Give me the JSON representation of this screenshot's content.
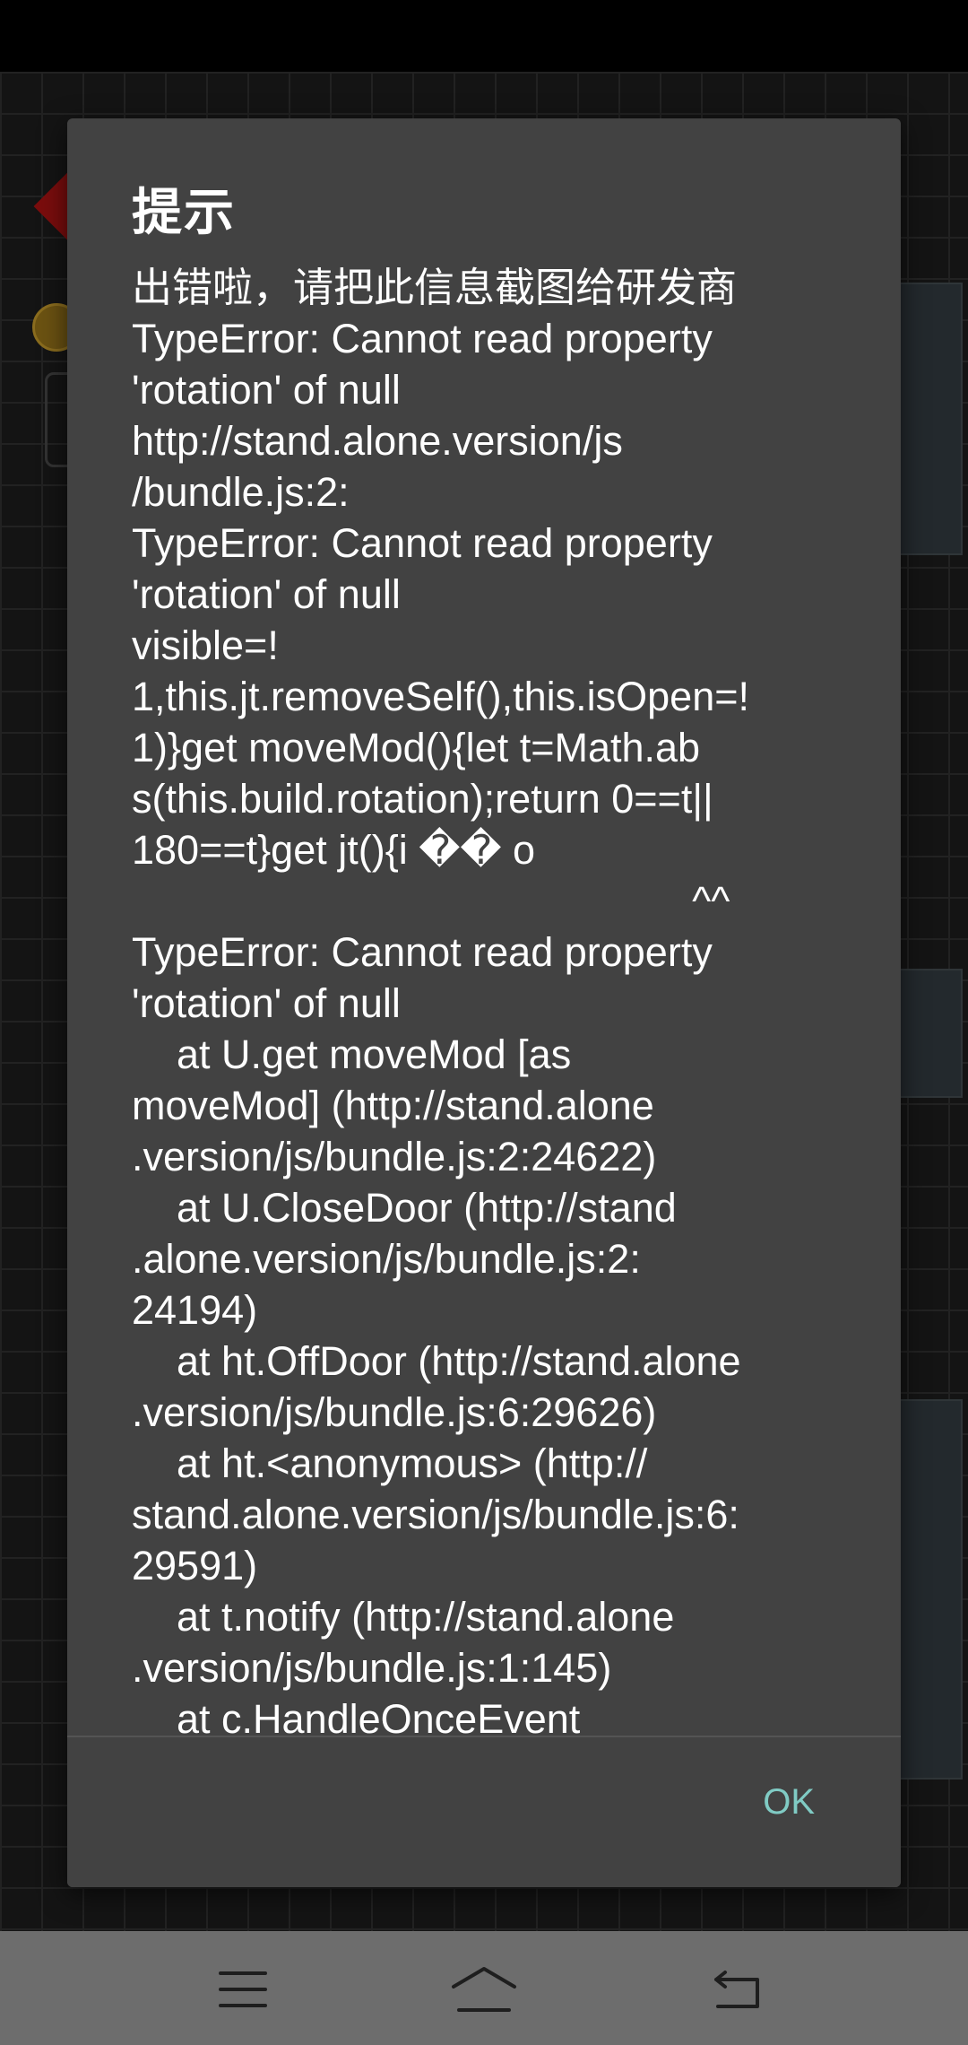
{
  "dialog": {
    "title": "提示",
    "message": "出错啦，请把此信息截图给研发商\nTypeError: Cannot read property\n'rotation' of null\nhttp://stand.alone.version/js\n/bundle.js:2:\nTypeError: Cannot read property\n'rotation' of null\nvisible=!\n1,this.jt.removeSelf(),this.isOpen=!\n1)}get moveMod(){let t=Math.ab\ns(this.build.rotation);return 0==t||\n180==t}get jt(){i �� o\n                                                  ^^\nTypeError: Cannot read property\n'rotation' of null\n    at U.get moveMod [as\nmoveMod] (http://stand.alone\n.version/js/bundle.js:2:24622)\n    at U.CloseDoor (http://stand\n.alone.version/js/bundle.js:2:\n24194)\n    at ht.OffDoor (http://stand.alone\n.version/js/bundle.js:6:29626)\n    at ht.<anonymous> (http://\nstand.alone.version/js/bundle.js:6:\n29591)\n    at t.notify (http://stand.alone\n.version/js/bundle.js:1:145)\n    at c.HandleOnceEvent",
    "ok_label": "OK"
  },
  "navbar": {
    "menu_icon": "menu-icon",
    "home_icon": "home-icon",
    "back_icon": "back-icon"
  },
  "colors": {
    "dialog_bg": "#424242",
    "accent": "#80cbc4",
    "navbar_bg": "#6d6d6d"
  }
}
